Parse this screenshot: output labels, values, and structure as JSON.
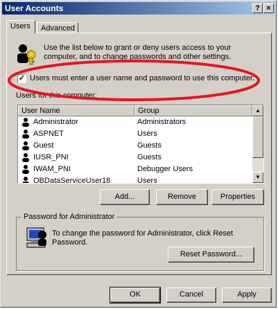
{
  "window": {
    "title": "User Accounts",
    "help_glyph": "?",
    "close_glyph": "×"
  },
  "tabs": [
    {
      "label": "Users"
    },
    {
      "label": "Advanced"
    }
  ],
  "intro_text": "Use the list below to grant or deny users access to your computer, and to change passwords and other settings.",
  "must_login": {
    "checked_glyph": "✓",
    "label": "Users must enter a user name and password to use this computer.",
    "checked": true
  },
  "users_list": {
    "label": "Users for this computer:",
    "columns": [
      "User Name",
      "Group"
    ],
    "rows": [
      {
        "name": "Administrator",
        "group": "Administrators"
      },
      {
        "name": "ASPNET",
        "group": "Users"
      },
      {
        "name": "Guest",
        "group": "Guests"
      },
      {
        "name": "IUSR_PNI",
        "group": "Guests"
      },
      {
        "name": "IWAM_PNI",
        "group": "Debugger Users"
      },
      {
        "name": "OBDataServiceUser18",
        "group": "Users"
      }
    ],
    "scroll_up_glyph": "▲",
    "scroll_down_glyph": "▼"
  },
  "actions": {
    "add": "Add...",
    "remove": "Remove",
    "properties": "Properties"
  },
  "password_group": {
    "label": "Password for Administrator",
    "text": "To change the password for Administrator, click Reset Password.",
    "reset": "Reset Password..."
  },
  "footer": {
    "ok": "OK",
    "cancel": "Cancel",
    "apply": "Apply"
  },
  "colors": {
    "annotation_ring": "#e8141e",
    "selection": "#0a246a",
    "face": "#d4d0c8"
  }
}
